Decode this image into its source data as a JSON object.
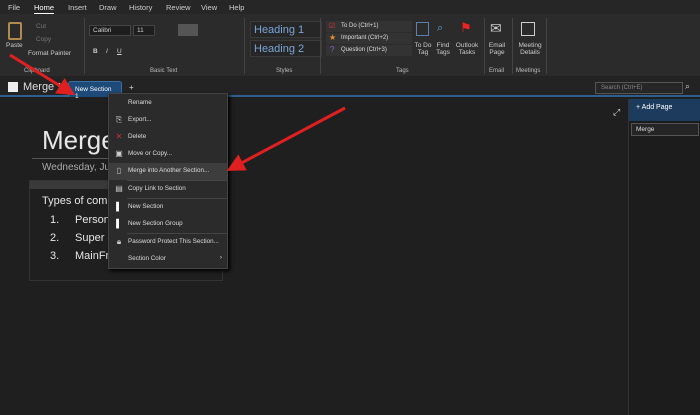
{
  "menu_tabs": [
    "File",
    "Home",
    "Insert",
    "Draw",
    "History",
    "Review",
    "View",
    "Help"
  ],
  "clipboard": {
    "paste": "Paste",
    "cut": "Cut",
    "copy": "Copy",
    "format_painter": "Format Painter",
    "group": "Clipboard"
  },
  "basic_text": {
    "font": "Calibri",
    "size": "11",
    "group": "Basic Text"
  },
  "styles": {
    "h1": "Heading 1",
    "h2": "Heading 2",
    "group": "Styles"
  },
  "tags": {
    "items": [
      "To Do (Ctrl+1)",
      "Important (Ctrl+2)",
      "Question (Ctrl+3)"
    ],
    "todo_tag": "To Do Tag",
    "find_tags": "Find Tags",
    "outlook_tasks": "Outlook Tasks",
    "group": "Tags"
  },
  "email": {
    "label": "Email Page",
    "group": "Email"
  },
  "meetings": {
    "label": "Meeting Details",
    "group": "Meetings"
  },
  "notebook": "Merge",
  "section_tab": "New Section 1",
  "add_section": "+",
  "search_placeholder": "Search (Ctrl+E)",
  "page": {
    "title": "Merge",
    "date": "Wednesday, Ju",
    "intro": "Types of com",
    "list": [
      {
        "n": "1.",
        "t": "Person"
      },
      {
        "n": "2.",
        "t": "Super C"
      },
      {
        "n": "3.",
        "t": "MainFr"
      }
    ]
  },
  "context_menu": [
    "Rename",
    "Export...",
    "Delete",
    "Move or Copy...",
    "Merge into Another Section...",
    "Copy Link to Section",
    "New Section",
    "New Section Group",
    "Password Protect This Section...",
    "Section Color"
  ],
  "pages_panel": {
    "add_page": "Add Page",
    "pages": [
      "Merge"
    ]
  },
  "colors": {
    "accent": "#2f5f8f",
    "arrow": "#e02020"
  }
}
